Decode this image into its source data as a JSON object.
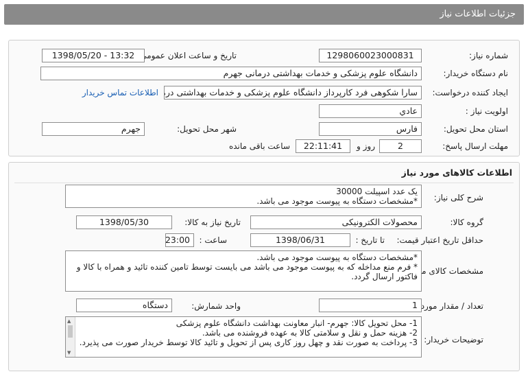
{
  "header": {
    "title": "جزئیات اطلاعات نیاز"
  },
  "need_info": {
    "need_number_label": "شماره نیاز:",
    "need_number": "1298060023000831",
    "announce_label": "تاریخ و ساعت اعلان عمومی:",
    "announce_value": "1398/05/20 - 13:32",
    "buyer_label": "نام دستگاه خریدار:",
    "buyer_value": "دانشگاه علوم پزشکی و خدمات بهداشتی درمانی جهرم",
    "creator_label": "ایجاد کننده درخواست:",
    "creator_value": "سارا شکوهی فرد کارپرداز دانشگاه علوم پزشکی و خدمات بهداشتی درمانی جه",
    "contact_link": "اطلاعات تماس خریدار",
    "priority_label": "اولویت نیاز :",
    "priority_value": "عادي",
    "province_label": "استان محل تحویل:",
    "province_value": "فارس",
    "city_label": "شهر محل تحویل:",
    "city_value": "جهرم",
    "deadline_label": "مهلت ارسال پاسخ:",
    "deadline_days": "2",
    "days_and": "روز و",
    "deadline_time": "22:11:41",
    "remaining_label": "ساعت باقی مانده"
  },
  "goods": {
    "section_title": "اطلاعات کالاهای مورد نیاز",
    "summary_label": "شرح کلی نیاز:",
    "summary_lines": [
      "یک عدد اسپیلت 30000",
      "*مشخصات دستگاه به پیوست موجود می باشد."
    ],
    "group_label": "گروه کالا:",
    "group_value": "محصولات الکترونیکی",
    "need_date_label": "تاریخ نیاز به کالا:",
    "need_date_value": "1398/05/30",
    "validity_label": "حداقل تاریخ اعتبار قیمت:",
    "until_date_label": "تا تاریخ :",
    "validity_date": "1398/06/31",
    "time_label": "ساعت :",
    "validity_time": "23:00",
    "specs_label": "مشخصات کالای مورد نیاز:",
    "specs_lines": [
      "*مشخصات دستگاه به پیوست موجود می باشد.",
      "* فرم منع مداخله که به پیوست موجود می باشد می بایست توسط تامین کننده تائید و همراه با کالا و فاکتور ارسال گردد."
    ],
    "qty_label": "تعداد / مقدار مورد نیاز:",
    "qty_value": "1",
    "unit_label": "واحد شمارش:",
    "unit_value": "دستگاه",
    "buyer_notes_label": "توضیحات خریدار:",
    "buyer_notes_lines": [
      "1- محل تحویل کالا: جهرم- انبار معاونت بهداشت دانشگاه علوم پزشکی",
      "2- هزینه حمل و نقل و سلامتی کالا به عهده فروشنده می باشد.",
      "3- پرداخت به صورت نقد و چهل روز کاری پس از تحویل و تائید کالا توسط خریدار صورت می پذیرد."
    ]
  }
}
